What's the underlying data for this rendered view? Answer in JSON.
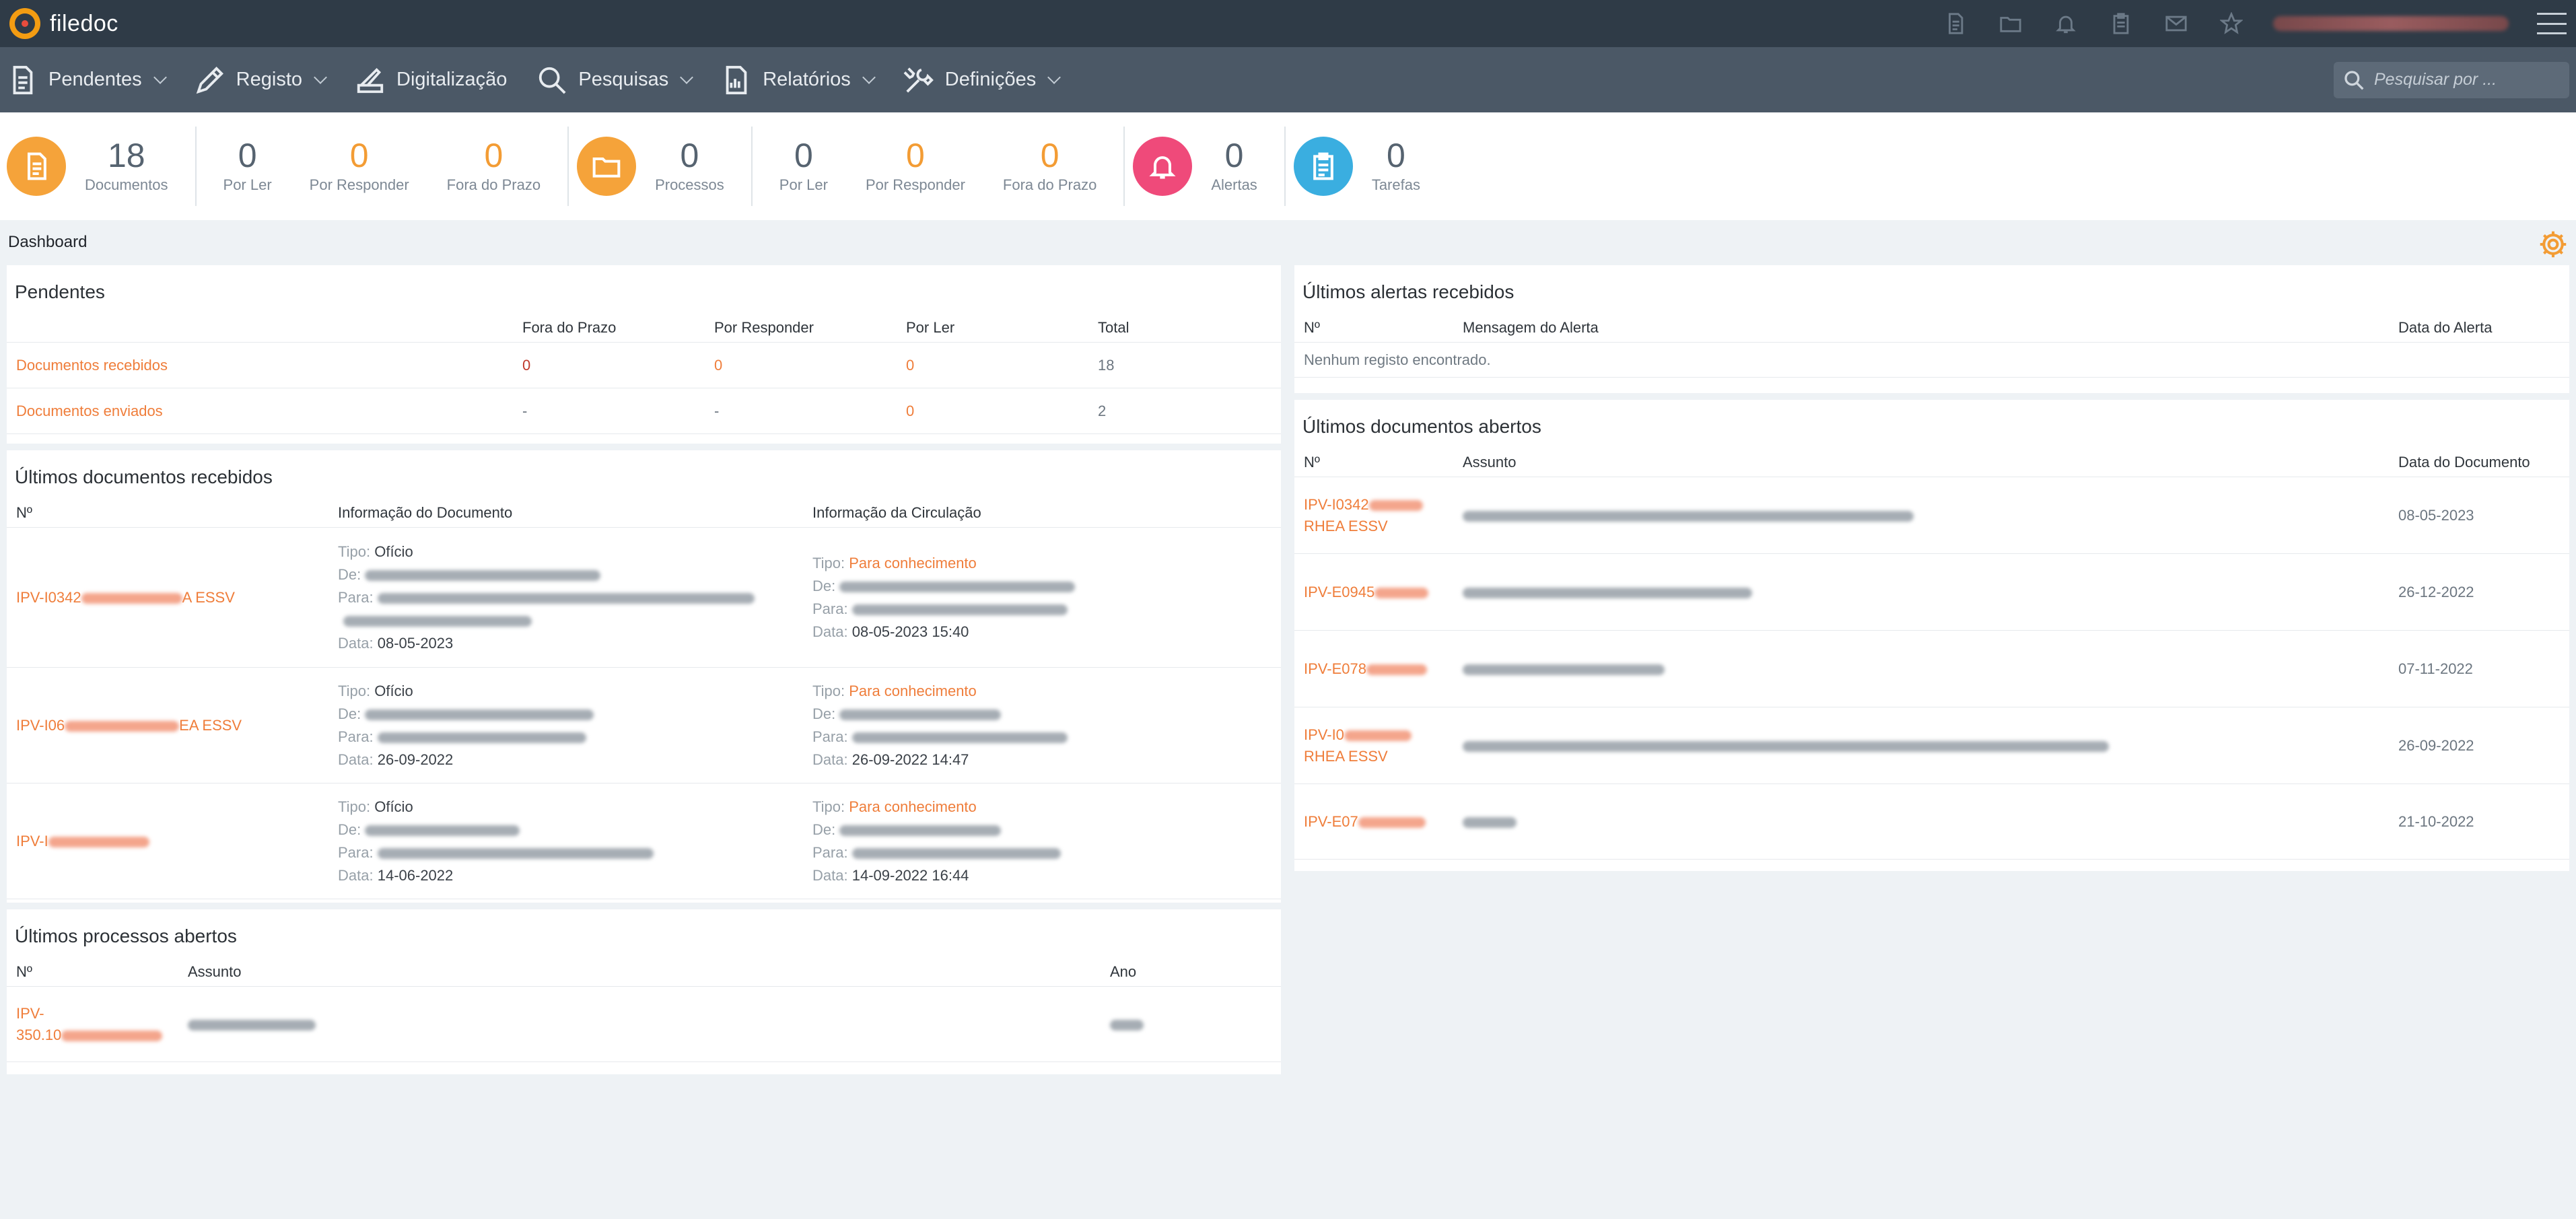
{
  "app": {
    "name": "filedoc"
  },
  "nav": {
    "items": [
      {
        "label": "Pendentes",
        "icon": "document-icon",
        "dropdown": true
      },
      {
        "label": "Registo",
        "icon": "pencil-icon",
        "dropdown": true
      },
      {
        "label": "Digitalização",
        "icon": "scanner-icon",
        "dropdown": false
      },
      {
        "label": "Pesquisas",
        "icon": "search-icon",
        "dropdown": true
      },
      {
        "label": "Relatórios",
        "icon": "report-icon",
        "dropdown": true
      },
      {
        "label": "Definições",
        "icon": "tools-icon",
        "dropdown": true
      }
    ],
    "search_placeholder": "Pesquisar por ..."
  },
  "stats": {
    "documentos": {
      "value": "18",
      "label": "Documentos"
    },
    "doc_por_ler": {
      "value": "0",
      "label": "Por Ler"
    },
    "doc_por_responder": {
      "value": "0",
      "label": "Por Responder"
    },
    "doc_fora_prazo": {
      "value": "0",
      "label": "Fora do Prazo"
    },
    "processos": {
      "value": "0",
      "label": "Processos"
    },
    "proc_por_ler": {
      "value": "0",
      "label": "Por Ler"
    },
    "proc_por_responder": {
      "value": "0",
      "label": "Por Responder"
    },
    "proc_fora_prazo": {
      "value": "0",
      "label": "Fora do Prazo"
    },
    "alertas": {
      "value": "0",
      "label": "Alertas"
    },
    "tarefas": {
      "value": "0",
      "label": "Tarefas"
    }
  },
  "colors": {
    "orange": "#f5a33a",
    "pink": "#ef4a7a",
    "blue": "#3aaee0",
    "link": "#ef7d3a"
  },
  "dashboard": {
    "title": "Dashboard"
  },
  "pendentes": {
    "title": "Pendentes",
    "headers": [
      "",
      "Fora do Prazo",
      "Por Responder",
      "Por Ler",
      "Total"
    ],
    "rows": [
      {
        "label": "Documentos recebidos",
        "fora": "0",
        "responder": "0",
        "ler": "0",
        "total": "18"
      },
      {
        "label": "Documentos enviados",
        "fora": "-",
        "responder": "-",
        "ler": "0",
        "total": "2"
      }
    ]
  },
  "ultimos_recebidos": {
    "title": "Últimos documentos recebidos",
    "headers": [
      "Nº",
      "Informação do Documento",
      "Informação da Circulação"
    ],
    "labels": {
      "tipo": "Tipo:",
      "de": "De:",
      "para": "Para:",
      "data": "Data:"
    },
    "rows": [
      {
        "num_prefix": "IPV-I0342",
        "num_suffix": "A ESSV",
        "doc_tipo": "Ofício",
        "doc_data": "08-05-2023",
        "circ_tipo": "Para conhecimento",
        "circ_data": "08-05-2023 15:40"
      },
      {
        "num_prefix": "IPV-I06",
        "num_suffix": "EA ESSV",
        "doc_tipo": "Ofício",
        "doc_data": "26-09-2022",
        "circ_tipo": "Para conhecimento",
        "circ_data": "26-09-2022 14:47"
      },
      {
        "num_prefix": "IPV-I",
        "num_suffix": "",
        "doc_tipo": "Ofício",
        "doc_data": "14-06-2022",
        "circ_tipo": "Para conhecimento",
        "circ_data": "14-09-2022 16:44"
      }
    ]
  },
  "ultimos_processos": {
    "title": "Últimos processos abertos",
    "headers": [
      "Nº",
      "Assunto",
      "Ano"
    ],
    "rows": [
      {
        "num_line1": "IPV-",
        "num_line2": "350.10"
      }
    ]
  },
  "ultimos_alertas": {
    "title": "Últimos alertas recebidos",
    "headers": [
      "Nº",
      "Mensagem do Alerta",
      "Data do Alerta"
    ],
    "empty": "Nenhum registo encontrado."
  },
  "ultimos_docs_abertos": {
    "title": "Últimos documentos abertos",
    "headers": [
      "Nº",
      "Assunto",
      "Data do Documento"
    ],
    "rows": [
      {
        "num_line1": "IPV-I0342",
        "num_line2": "RHEA ESSV",
        "date": "08-05-2023"
      },
      {
        "num_line1": "IPV-E0945",
        "num_line2": "",
        "date": "26-12-2022"
      },
      {
        "num_line1": "IPV-E078",
        "num_line2": "",
        "date": "07-11-2022"
      },
      {
        "num_line1": "IPV-I0",
        "num_line2": "RHEA ESSV",
        "date": "26-09-2022"
      },
      {
        "num_line1": "IPV-E07",
        "num_line2": "",
        "date": "21-10-2022"
      }
    ]
  }
}
